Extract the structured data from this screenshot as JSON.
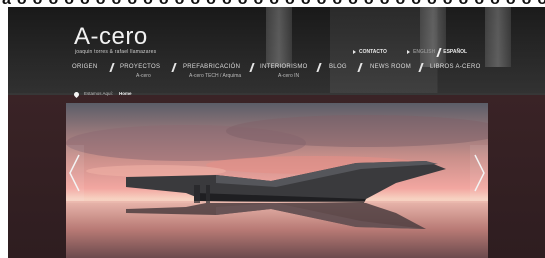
{
  "header": {
    "cut_top_text": "aoooooooooooooooooooooooooooooooooo",
    "logo": "A-cero",
    "tagline": "joaquin torres & rafael llamazares"
  },
  "top_links": {
    "contact": "CONTACTO",
    "english": "ENGLISH",
    "spanish": "ESPAÑOL"
  },
  "nav": {
    "items": [
      {
        "label": "ORIGEN",
        "sub": ""
      },
      {
        "label": "PROYECTOS",
        "sub": "A-cero"
      },
      {
        "label": "PREFABRICACIÓN",
        "sub": "A-cero TECH / Arquima"
      },
      {
        "label": "INTERIORISMO",
        "sub": "A-cero IN"
      },
      {
        "label": "BLOG",
        "sub": ""
      },
      {
        "label": "NEWS ROOM",
        "sub": ""
      },
      {
        "label": "LIBROS A-CERO",
        "sub": ""
      }
    ]
  },
  "breadcrumb": {
    "label": "Estamos Aquí:",
    "current": "Home"
  },
  "icons": {
    "location": "map-pin-icon",
    "prev": "chevron-left-icon",
    "next": "chevron-right-icon",
    "contact": "triangle-right-icon",
    "language": "triangle-right-icon"
  },
  "colors": {
    "page_background": "#ffffff",
    "site_background": "#2b2b2b",
    "header_text": "#f2f2f2",
    "slider_band": "#2e1d20",
    "sky_pink": "#f2a6a0"
  }
}
